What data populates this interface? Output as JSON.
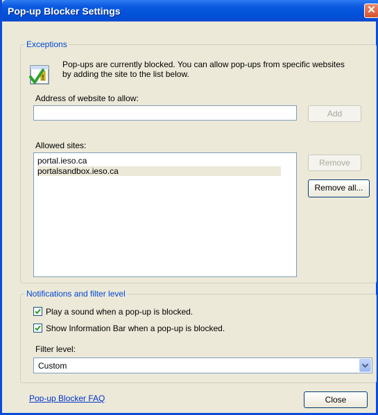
{
  "window": {
    "title": "Pop-up Blocker Settings"
  },
  "exceptions": {
    "legend": "Exceptions",
    "info_text": "Pop-ups are currently blocked.  You can allow pop-ups from specific websites by adding the site to the list below.",
    "address_label": "Address of website to allow:",
    "address_value": "",
    "add_label": "Add",
    "allowed_label": "Allowed sites:",
    "sites": [
      "portal.ieso.ca",
      "portalsandbox.ieso.ca"
    ],
    "selected_index": 1,
    "remove_label": "Remove",
    "remove_all_label": "Remove all..."
  },
  "notifications": {
    "legend": "Notifications and filter level",
    "play_sound_label": "Play a sound when a pop-up is blocked.",
    "play_sound_checked": true,
    "info_bar_label": "Show Information Bar when a pop-up is blocked.",
    "info_bar_checked": true,
    "filter_label": "Filter level:",
    "filter_value": "Custom"
  },
  "footer": {
    "faq_link": "Pop-up Blocker FAQ",
    "close_label": "Close"
  },
  "colors": {
    "title_bar": "#0b5ae0",
    "legend_text": "#0046d5",
    "face": "#ece9d8"
  }
}
